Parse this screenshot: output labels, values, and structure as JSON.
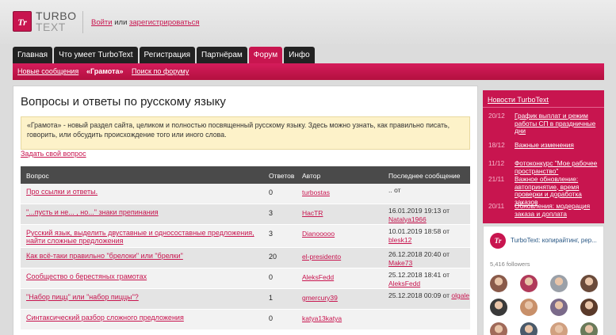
{
  "header": {
    "brand_line1": "TURBO",
    "brand_line2": "TEXT",
    "logo_letters": "Tr",
    "login": "Войти",
    "or": "или",
    "register": "зарегистрироваться"
  },
  "nav": {
    "tabs": [
      {
        "label": "Главная",
        "active": false
      },
      {
        "label": "Что умеет TurboText",
        "active": false
      },
      {
        "label": "Регистрация",
        "active": false
      },
      {
        "label": "Партнёрам",
        "active": false
      },
      {
        "label": "Форум",
        "active": true
      },
      {
        "label": "Инфо",
        "active": false
      }
    ]
  },
  "subnav": {
    "new_messages": "Новые сообщения",
    "current": "«Грамота»",
    "search": "Поиск по форуму"
  },
  "main": {
    "title": "Вопросы и ответы по русскому языку",
    "notice": "«Грамота» - новый раздел сайта, целиком и полностью посвященный русскому языку. Здесь можно узнать, как правильно писать, говорить, или обсудить происхождение того или иного слова.",
    "ask_link": "Задать свой вопрос"
  },
  "table": {
    "headers": {
      "question": "Вопрос",
      "answers": "Ответов",
      "author": "Автор",
      "last": "Последнее сообщение"
    },
    "rows": [
      {
        "title": "Про ссылки и ответы.",
        "answers": "0",
        "author": "turbostas",
        "last_date": ".. от",
        "last_user": ""
      },
      {
        "title": "\"...пусть и не... , но...\" знаки препинания",
        "answers": "3",
        "author": "HacTR",
        "last_date": "16.01.2019 19:13 от",
        "last_user": "Natalya1966"
      },
      {
        "title": "Русский язык, выделить двуставные и односоставные предложения, найти сложные предложения",
        "answers": "3",
        "author": "Dianooooo",
        "last_date": "10.01.2019 18:58 от",
        "last_user": "blesk12"
      },
      {
        "title": "Как всё-таки правильно \"брелоки\" или \"брелки\"",
        "answers": "20",
        "author": "el-presidento",
        "last_date": "26.12.2018 20:40 от",
        "last_user": "Make73"
      },
      {
        "title": "Сообщество о берестяных грамотах",
        "answers": "0",
        "author": "AleksFedd",
        "last_date": "25.12.2018 18:41 от",
        "last_user": "AleksFedd"
      },
      {
        "title": "\"Набор пицц\" или \"набор пиццы\"?",
        "answers": "1",
        "author": "gmercury39",
        "last_date": "25.12.2018 00:09 от",
        "last_user": "olgale"
      },
      {
        "title": "Синтаксический разбор сложного предложения",
        "answers": "0",
        "author": "katya13katya",
        "last_date": "",
        "last_user": ""
      }
    ]
  },
  "news": {
    "title": "Новости TurboText",
    "items": [
      {
        "date": "20/12",
        "text": "График выплат и режим работы СП в праздничные дни"
      },
      {
        "date": "18/12",
        "text": "Важные изменения"
      },
      {
        "date": "11/12",
        "text": "Фотоконкурс \"Мое рабочее пространство\""
      },
      {
        "date": "21/11",
        "text": "Важное обновление: автопринятие, время проверки и доработка заказов"
      },
      {
        "date": "20/11",
        "text": "Обновления: модерация заказа и доплата"
      }
    ]
  },
  "vk": {
    "name": "TurboText: копирайтинг, рер...",
    "followers": "5,416 followers",
    "avatar_colors": [
      "#8a5a4a",
      "#b03a5a",
      "#9aa0a8",
      "#6a4a3a",
      "#3a3a3a",
      "#c8906a",
      "#7a6a8a",
      "#5a3a2a",
      "#a06a5a",
      "#4a5a6a",
      "#d0a080",
      "#6a7a5a"
    ]
  }
}
